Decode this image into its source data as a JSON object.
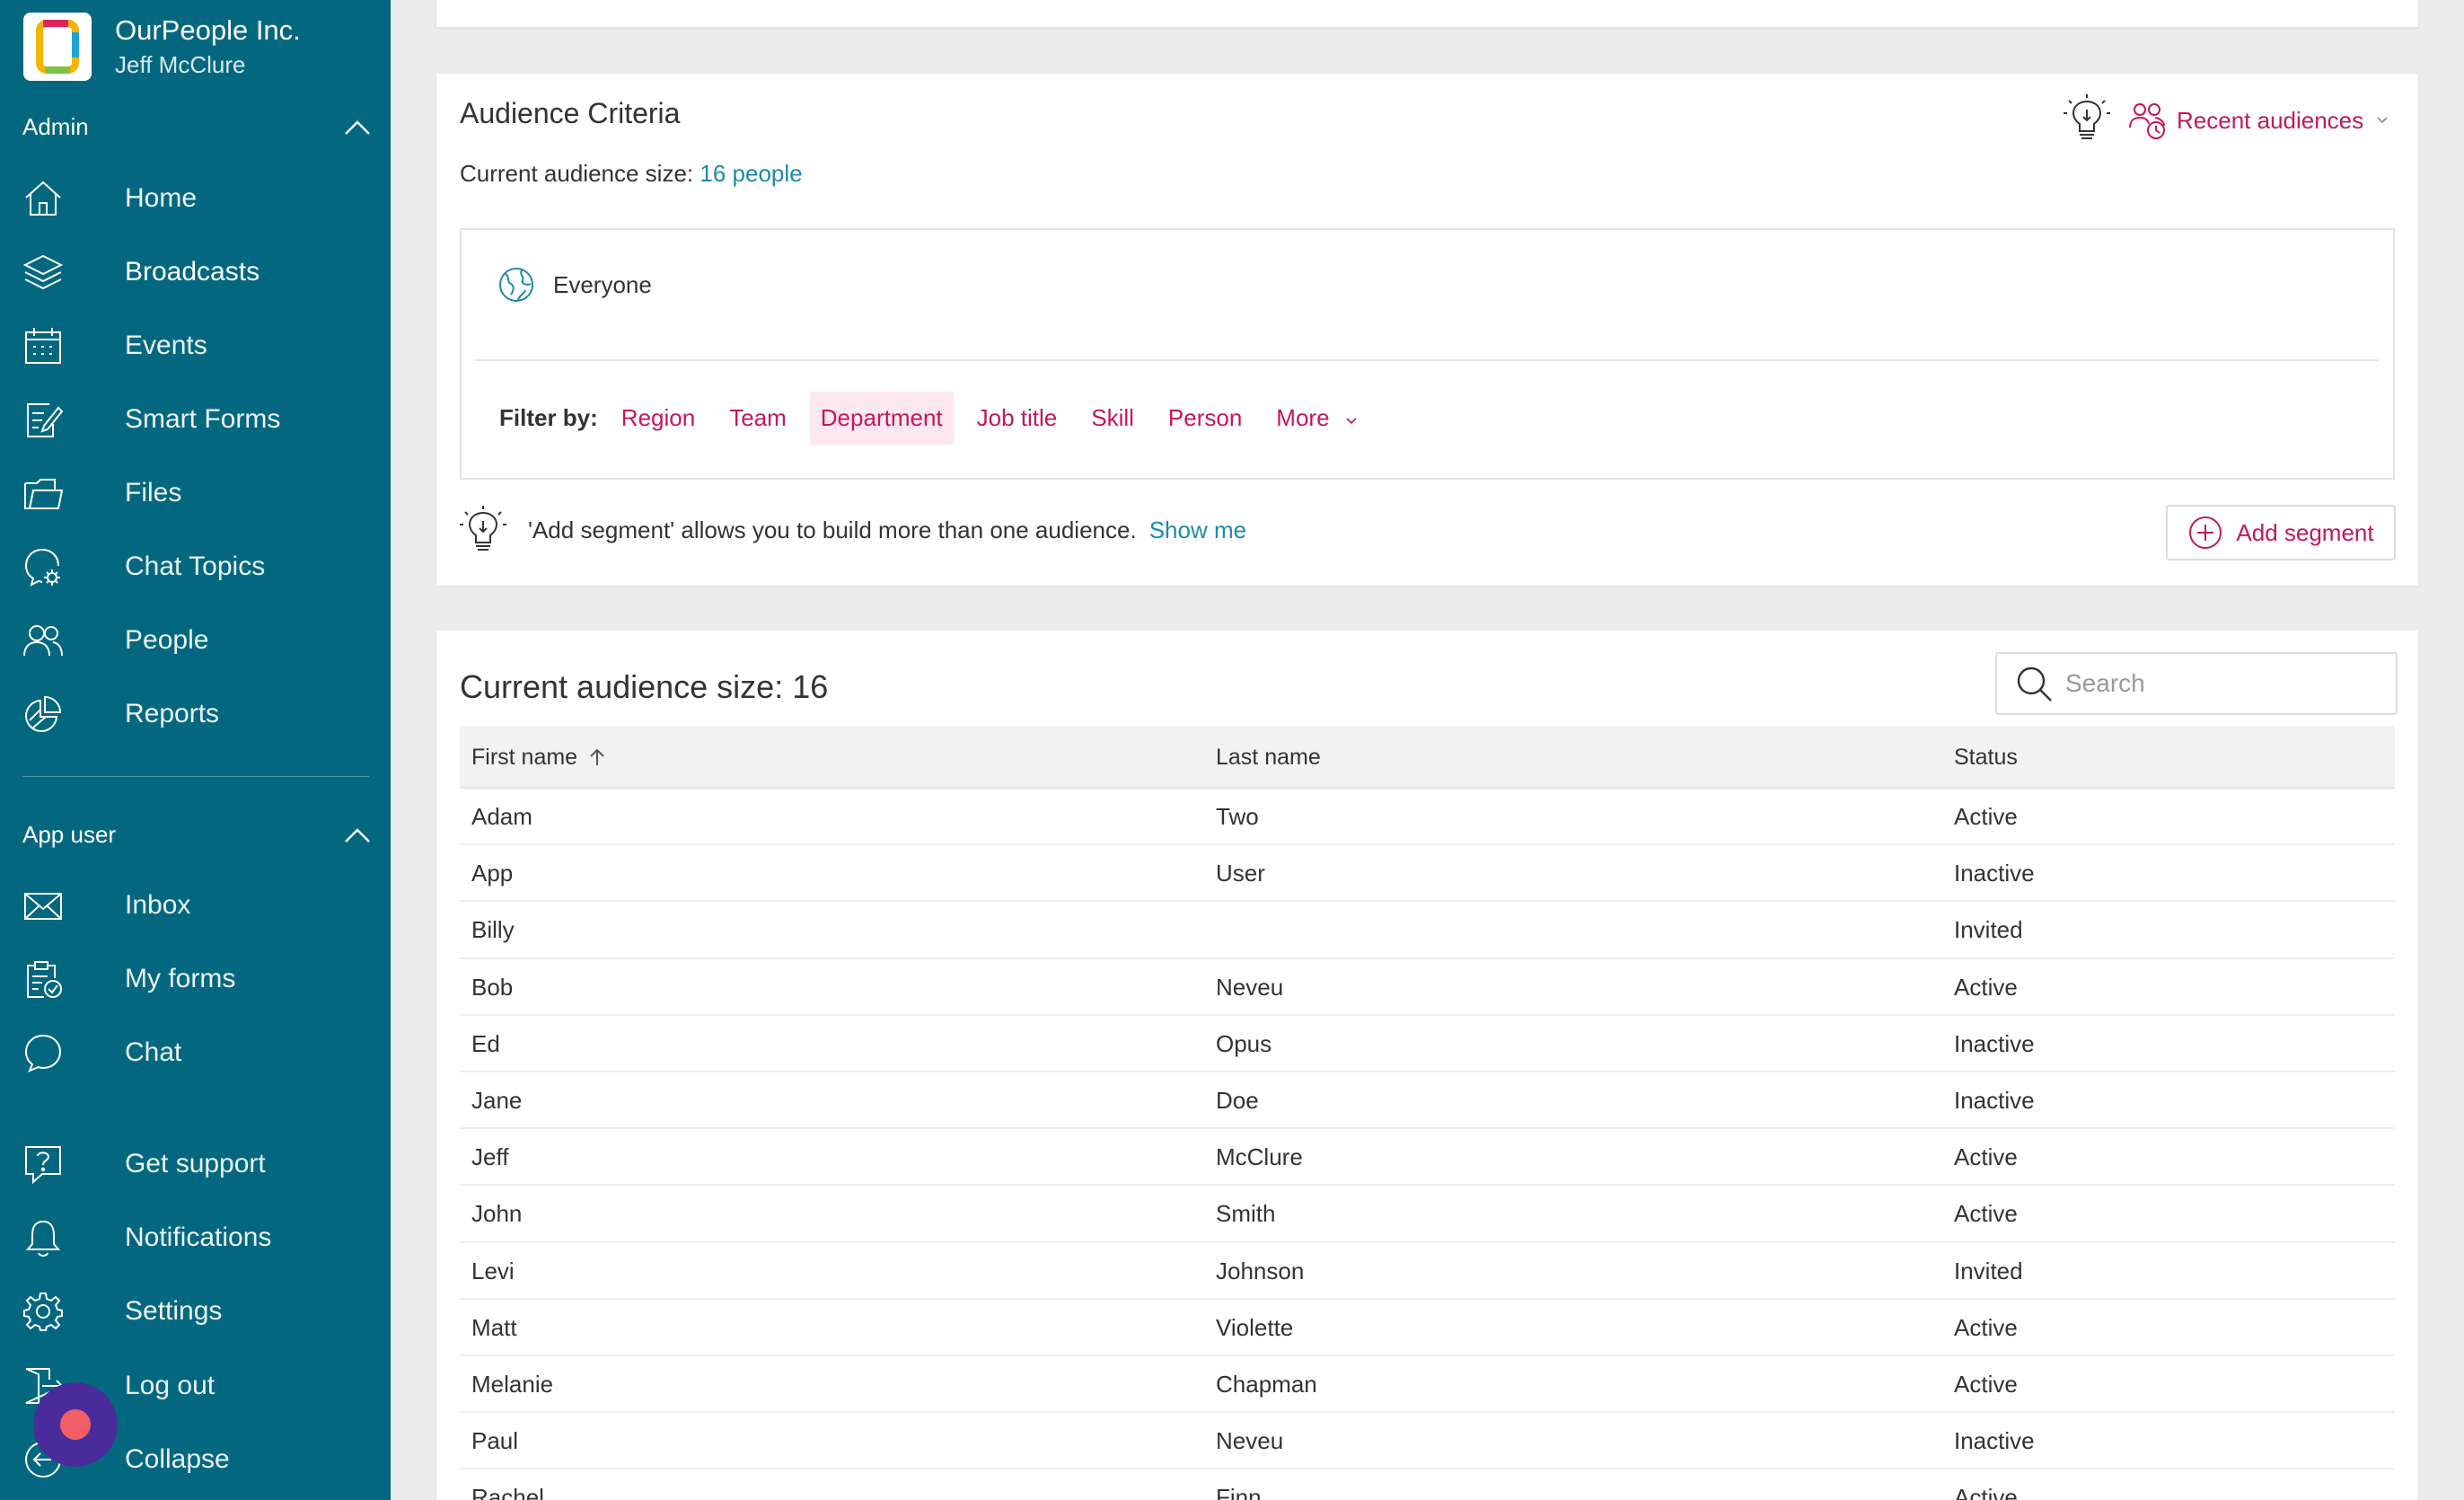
{
  "org": {
    "name": "OurPeople Inc.",
    "user": "Jeff McClure"
  },
  "sidebar": {
    "admin_label": "Admin",
    "admin_items": [
      {
        "label": "Home",
        "icon": "home-icon"
      },
      {
        "label": "Broadcasts",
        "icon": "layers-icon"
      },
      {
        "label": "Events",
        "icon": "calendar-icon"
      },
      {
        "label": "Smart Forms",
        "icon": "form-edit-icon"
      },
      {
        "label": "Files",
        "icon": "folder-icon"
      },
      {
        "label": "Chat Topics",
        "icon": "chat-gear-icon"
      },
      {
        "label": "People",
        "icon": "people-icon"
      },
      {
        "label": "Reports",
        "icon": "pie-chart-icon"
      }
    ],
    "app_user_label": "App user",
    "app_user_items": [
      {
        "label": "Inbox",
        "icon": "envelope-icon"
      },
      {
        "label": "My forms",
        "icon": "clipboard-check-icon"
      },
      {
        "label": "Chat",
        "icon": "chat-bubble-icon"
      }
    ],
    "footer_items": [
      {
        "label": "Get support",
        "icon": "help-icon"
      },
      {
        "label": "Notifications",
        "icon": "bell-icon"
      },
      {
        "label": "Settings",
        "icon": "gear-icon"
      },
      {
        "label": "Log out",
        "icon": "logout-icon"
      },
      {
        "label": "Collapse",
        "icon": "collapse-icon"
      }
    ]
  },
  "criteria": {
    "title": "Audience Criteria",
    "size_label": "Current audience size:",
    "size_link": "16 people",
    "recent_label": "Recent audiences",
    "everyone_label": "Everyone",
    "filter_label": "Filter by:",
    "filters": [
      "Region",
      "Team",
      "Department",
      "Job title",
      "Skill",
      "Person"
    ],
    "more_label": "More",
    "segment_hint": "'Add segment' allows you to build more than one audience.",
    "show_me": "Show me",
    "add_segment": "Add segment"
  },
  "table": {
    "title": "Current audience size: 16",
    "search_placeholder": "Search",
    "columns": [
      "First name",
      "Last name",
      "Status"
    ],
    "rows": [
      [
        "Adam",
        "Two",
        "Active"
      ],
      [
        "App",
        "User",
        "Inactive"
      ],
      [
        "Billy",
        "",
        "Invited"
      ],
      [
        "Bob",
        "Neveu",
        "Active"
      ],
      [
        "Ed",
        "Opus",
        "Inactive"
      ],
      [
        "Jane",
        "Doe",
        "Inactive"
      ],
      [
        "Jeff",
        "McClure",
        "Active"
      ],
      [
        "John",
        "Smith",
        "Active"
      ],
      [
        "Levi",
        "Johnson",
        "Invited"
      ],
      [
        "Matt",
        "Violette",
        "Active"
      ],
      [
        "Melanie",
        "Chapman",
        "Active"
      ],
      [
        "Paul",
        "Neveu",
        "Inactive"
      ],
      [
        "Rachel",
        "Finn",
        "Active"
      ]
    ]
  },
  "colors": {
    "sidebar": "#03687f",
    "accent": "#c2185b",
    "link": "#1d8aa8"
  }
}
